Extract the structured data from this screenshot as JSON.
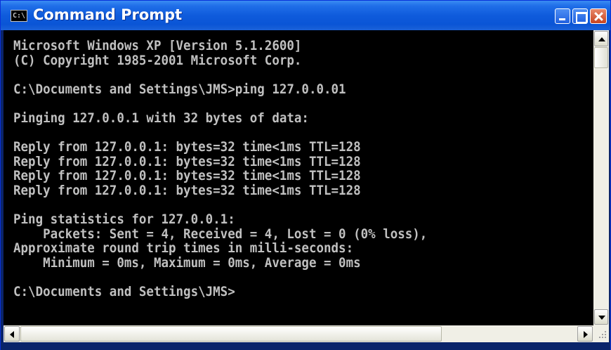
{
  "window": {
    "title": "Command Prompt",
    "icon_label": "C:\\",
    "icon": "console-app-icon"
  },
  "titlebar_buttons": {
    "minimize": "minimize-icon",
    "maximize": "maximize-icon",
    "close": "close-icon"
  },
  "console": {
    "lines": [
      "Microsoft Windows XP [Version 5.1.2600]",
      "(C) Copyright 1985-2001 Microsoft Corp.",
      "",
      "C:\\Documents and Settings\\JMS>ping 127.0.0.01",
      "",
      "Pinging 127.0.0.1 with 32 bytes of data:",
      "",
      "Reply from 127.0.0.1: bytes=32 time<1ms TTL=128",
      "Reply from 127.0.0.1: bytes=32 time<1ms TTL=128",
      "Reply from 127.0.0.1: bytes=32 time<1ms TTL=128",
      "Reply from 127.0.0.1: bytes=32 time<1ms TTL=128",
      "",
      "Ping statistics for 127.0.0.1:",
      "    Packets: Sent = 4, Received = 4, Lost = 0 (0% loss),",
      "Approximate round trip times in milli-seconds:",
      "    Minimum = 0ms, Maximum = 0ms, Average = 0ms",
      "",
      "C:\\Documents and Settings\\JMS>"
    ]
  },
  "colors": {
    "console_bg": "#000000",
    "console_fg": "#c0c0c0",
    "titlebar": "#0a55d6"
  }
}
